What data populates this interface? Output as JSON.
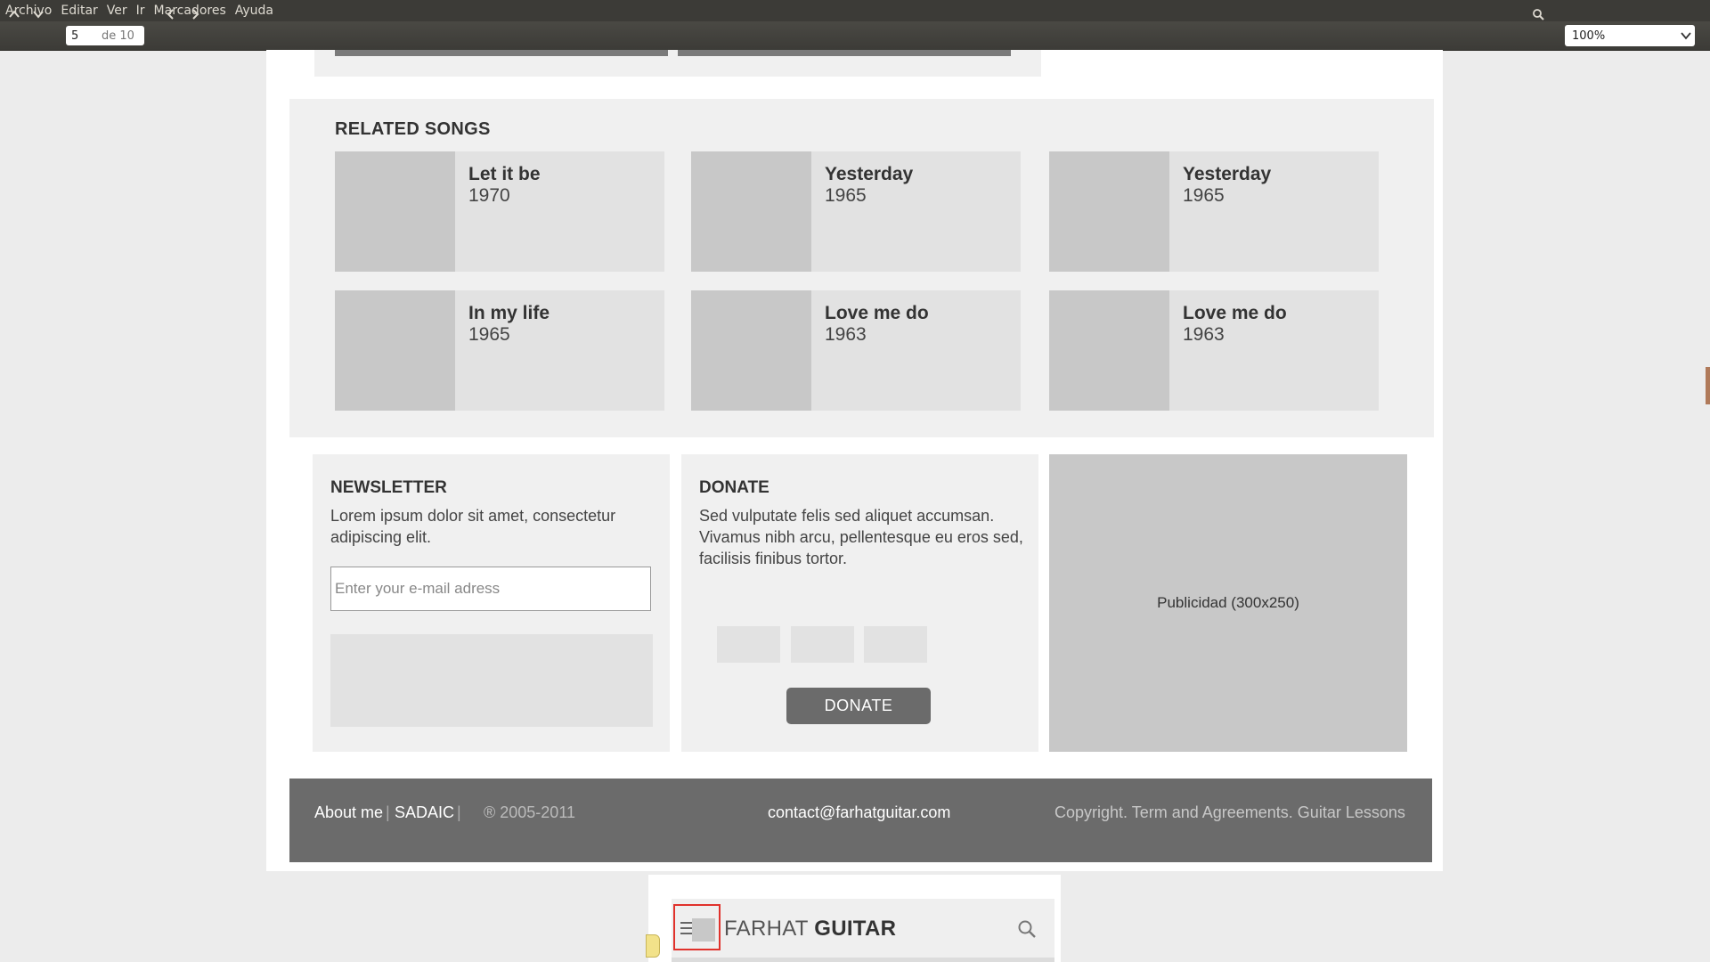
{
  "menubar": {
    "items": [
      "Archivo",
      "Editar",
      "Ver",
      "Ir",
      "Marcadores",
      "Ayuda"
    ]
  },
  "toolbar": {
    "page_number": "5",
    "page_of": "de 10",
    "zoom": "100%"
  },
  "related": {
    "title": "RELATED SONGS",
    "songs": [
      {
        "title": "Let it be",
        "year": "1970"
      },
      {
        "title": "Yesterday",
        "year": "1965"
      },
      {
        "title": "Yesterday",
        "year": "1965"
      },
      {
        "title": "In my life",
        "year": "1965"
      },
      {
        "title": "Love me do",
        "year": "1963"
      },
      {
        "title": "Love me do",
        "year": "1963"
      }
    ]
  },
  "newsletter": {
    "title": "NEWSLETTER",
    "text": "Lorem ipsum dolor sit amet, consectetur adipiscing elit.",
    "email_placeholder": "Enter your e-mail adress"
  },
  "donate": {
    "title": "DONATE",
    "text": "Sed vulputate felis sed aliquet accumsan. Vivamus nibh arcu, pellentesque eu eros sed, facilisis finibus tortor.",
    "button_label": "DONATE"
  },
  "ad": {
    "label": "Publicidad (300x250)"
  },
  "footer": {
    "about": "About me",
    "sep1": "|",
    "sadaic": "SADAIC",
    "sep2": "|",
    "years": "® 2005-2011",
    "email": "contact@farhatguitar.com",
    "terms": "Copyright. Term and Agreements. Guitar Lessons"
  },
  "mobile": {
    "logo_light": "FARHAT",
    "logo_bold": "GUITAR"
  },
  "colors": {
    "menubar": "#3c3b37",
    "panel_bg": "#f0f0f0",
    "placeholder_gray": "#c8c8c8",
    "footer_bg": "#6b6b6b",
    "highlight_red": "#e0322c"
  },
  "icons": [
    "chevron-up-icon",
    "chevron-down-icon",
    "chevron-left-icon",
    "chevron-right-icon",
    "search-icon",
    "menu-icon"
  ]
}
